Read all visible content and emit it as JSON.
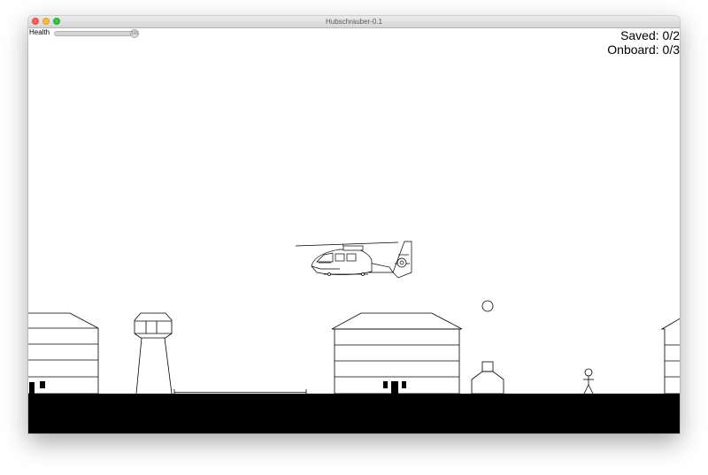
{
  "window": {
    "title": "Hubschrauber-0.1"
  },
  "hud": {
    "health_label": "Health",
    "health_value": 100,
    "health_max": 100,
    "saved_label": "Saved: 0/2",
    "onboard_label": "Onboard: 0/3"
  },
  "colors": {
    "ground": "#000000",
    "outline": "#000000",
    "background": "#ffffff"
  },
  "icons": {
    "close": "traffic-light-red",
    "minimize": "traffic-light-yellow",
    "zoom": "traffic-light-green"
  }
}
